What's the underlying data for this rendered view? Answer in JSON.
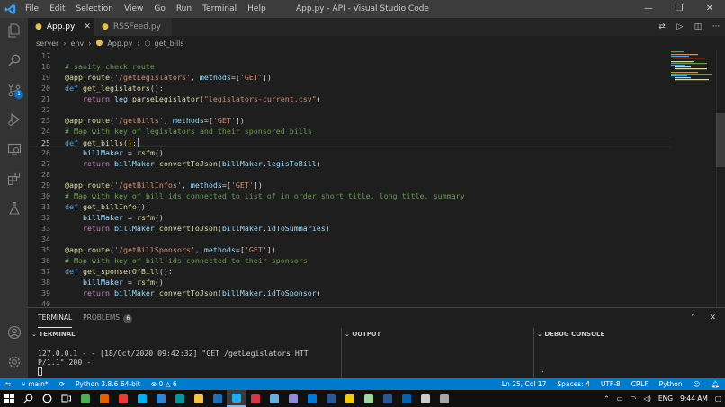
{
  "window": {
    "title": "App.py - API - Visual Studio Code",
    "menu": [
      "File",
      "Edit",
      "Selection",
      "View",
      "Go",
      "Run",
      "Terminal",
      "Help"
    ],
    "controls": [
      "—",
      "❐",
      "✕"
    ]
  },
  "activity_bar": {
    "items": [
      "explorer-icon",
      "search-icon",
      "source-control-icon",
      "run-debug-icon",
      "remote-explorer-icon",
      "extensions-icon",
      "testing-icon"
    ],
    "source_control_badge": "1",
    "bottom": [
      "account-icon",
      "manage-gear-icon"
    ]
  },
  "tabs": [
    {
      "label": "App.py",
      "active": true
    },
    {
      "label": "RSSFeed.py",
      "active": false
    }
  ],
  "breadcrumb": [
    "server",
    "env",
    "App.py",
    "get_bills"
  ],
  "editor": {
    "lines": [
      {
        "n": "17",
        "tokens": []
      },
      {
        "n": "18",
        "tokens": [
          [
            "c",
            "# sanity check route"
          ]
        ]
      },
      {
        "n": "19",
        "tokens": [
          [
            "dec",
            "@app.route"
          ],
          [
            "p",
            "("
          ],
          [
            "s",
            "'/getLegislators'"
          ],
          [
            "p",
            ", "
          ],
          [
            "v",
            "methods"
          ],
          [
            "p",
            "=["
          ],
          [
            "s",
            "'GET'"
          ],
          [
            "p",
            "])"
          ]
        ]
      },
      {
        "n": "20",
        "tokens": [
          [
            "kb",
            "def "
          ],
          [
            "fn",
            "get_legislators"
          ],
          [
            "p",
            "():"
          ]
        ]
      },
      {
        "n": "21",
        "tokens": [
          [
            "p",
            "    "
          ],
          [
            "k",
            "return "
          ],
          [
            "v",
            "leg"
          ],
          [
            "p",
            "."
          ],
          [
            "fn",
            "parseLegislator"
          ],
          [
            "p",
            "("
          ],
          [
            "s",
            "\"legislators-current.csv\""
          ],
          [
            "p",
            ")"
          ]
        ]
      },
      {
        "n": "22",
        "tokens": []
      },
      {
        "n": "23",
        "tokens": [
          [
            "dec",
            "@app.route"
          ],
          [
            "p",
            "("
          ],
          [
            "s",
            "'/getBills'"
          ],
          [
            "p",
            ", "
          ],
          [
            "v",
            "methods"
          ],
          [
            "p",
            "=["
          ],
          [
            "s",
            "'GET'"
          ],
          [
            "p",
            "])"
          ]
        ]
      },
      {
        "n": "24",
        "tokens": [
          [
            "c",
            "# Map with key of legislators and their sponsored bills"
          ]
        ]
      },
      {
        "n": "25",
        "tokens": [
          [
            "kb",
            "def "
          ],
          [
            "fn",
            "get_bills"
          ],
          [
            "b",
            "()"
          ],
          [
            "p",
            ":"
          ]
        ],
        "current": true
      },
      {
        "n": "26",
        "tokens": [
          [
            "p",
            "    "
          ],
          [
            "v",
            "billMaker"
          ],
          [
            "p",
            " = "
          ],
          [
            "fn",
            "rsfm"
          ],
          [
            "p",
            "()"
          ]
        ]
      },
      {
        "n": "27",
        "tokens": [
          [
            "p",
            "    "
          ],
          [
            "k",
            "return "
          ],
          [
            "v",
            "billMaker"
          ],
          [
            "p",
            "."
          ],
          [
            "fn",
            "convertToJson"
          ],
          [
            "p",
            "("
          ],
          [
            "v",
            "billMaker"
          ],
          [
            "p",
            "."
          ],
          [
            "v",
            "legisToBill"
          ],
          [
            "p",
            ")"
          ]
        ]
      },
      {
        "n": "28",
        "tokens": []
      },
      {
        "n": "29",
        "tokens": [
          [
            "dec",
            "@app.route"
          ],
          [
            "p",
            "("
          ],
          [
            "s",
            "'/getBillInfos'"
          ],
          [
            "p",
            ", "
          ],
          [
            "v",
            "methods"
          ],
          [
            "p",
            "=["
          ],
          [
            "s",
            "'GET'"
          ],
          [
            "p",
            "])"
          ]
        ]
      },
      {
        "n": "30",
        "tokens": [
          [
            "c",
            "# Map with key of bill ids connected to list of in order short title, long title, summary"
          ]
        ]
      },
      {
        "n": "31",
        "tokens": [
          [
            "kb",
            "def "
          ],
          [
            "fn",
            "get_billInfo"
          ],
          [
            "p",
            "():"
          ]
        ]
      },
      {
        "n": "32",
        "tokens": [
          [
            "p",
            "    "
          ],
          [
            "v",
            "billMaker"
          ],
          [
            "p",
            " = "
          ],
          [
            "fn",
            "rsfm"
          ],
          [
            "p",
            "()"
          ]
        ]
      },
      {
        "n": "33",
        "tokens": [
          [
            "p",
            "    "
          ],
          [
            "k",
            "return "
          ],
          [
            "v",
            "billMaker"
          ],
          [
            "p",
            "."
          ],
          [
            "fn",
            "convertToJson"
          ],
          [
            "p",
            "("
          ],
          [
            "v",
            "billMaker"
          ],
          [
            "p",
            "."
          ],
          [
            "v",
            "idToSummaries"
          ],
          [
            "p",
            ")"
          ]
        ]
      },
      {
        "n": "34",
        "tokens": []
      },
      {
        "n": "35",
        "tokens": [
          [
            "dec",
            "@app.route"
          ],
          [
            "p",
            "("
          ],
          [
            "s",
            "'/getBillSponsors'"
          ],
          [
            "p",
            ", "
          ],
          [
            "v",
            "methods"
          ],
          [
            "p",
            "=["
          ],
          [
            "s",
            "'GET'"
          ],
          [
            "p",
            "])"
          ]
        ]
      },
      {
        "n": "36",
        "tokens": [
          [
            "c",
            "# Map with key of bill ids connected to their sponsors"
          ]
        ]
      },
      {
        "n": "37",
        "tokens": [
          [
            "kb",
            "def "
          ],
          [
            "fn",
            "get_sponserOfBill"
          ],
          [
            "p",
            "():"
          ]
        ]
      },
      {
        "n": "38",
        "tokens": [
          [
            "p",
            "    "
          ],
          [
            "v",
            "billMaker"
          ],
          [
            "p",
            " = "
          ],
          [
            "fn",
            "rsfm"
          ],
          [
            "p",
            "()"
          ]
        ]
      },
      {
        "n": "39",
        "tokens": [
          [
            "p",
            "    "
          ],
          [
            "k",
            "return "
          ],
          [
            "v",
            "billMaker"
          ],
          [
            "p",
            "."
          ],
          [
            "fn",
            "convertToJson"
          ],
          [
            "p",
            "("
          ],
          [
            "v",
            "billMaker"
          ],
          [
            "p",
            "."
          ],
          [
            "v",
            "idToSponsor"
          ],
          [
            "p",
            ")"
          ]
        ]
      },
      {
        "n": "40",
        "tokens": []
      }
    ]
  },
  "panel": {
    "tabs": [
      {
        "label": "TERMINAL",
        "active": true
      },
      {
        "label": "PROBLEMS",
        "active": false,
        "count": "6"
      }
    ],
    "sections": {
      "terminal": "TERMINAL",
      "output": "OUTPUT",
      "debug": "DEBUG CONSOLE"
    },
    "terminal_lines": [
      "127.0.0.1 - - [18/Oct/2020 09:42:32] \"GET /getLegislators HTT",
      "P/1.1\" 200 -"
    ]
  },
  "statusbar": {
    "branch": "main*",
    "python": "Python 3.8.6 64-bit",
    "errors": "0",
    "warnings": "6",
    "position": "Ln 25, Col 17",
    "spaces": "Spaces: 4",
    "encoding": "UTF-8",
    "eol": "CRLF",
    "language": "Python"
  },
  "taskbar": {
    "apps": [
      {
        "name": "chrome-icon",
        "color": "#4caf50"
      },
      {
        "name": "firefox-icon",
        "color": "#e66000"
      },
      {
        "name": "vivaldi-icon",
        "color": "#ef3939"
      },
      {
        "name": "skype-icon",
        "color": "#00aff0"
      },
      {
        "name": "copilot-icon",
        "color": "#2b88d8"
      },
      {
        "name": "arduino-icon",
        "color": "#00979c"
      },
      {
        "name": "file-explorer-icon",
        "color": "#f6c343"
      },
      {
        "name": "files-icon",
        "color": "#1d6fb8"
      },
      {
        "name": "vscode-taskbar-icon",
        "color": "#23a9f2",
        "active": true
      },
      {
        "name": "pdf-icon",
        "color": "#d4374a"
      },
      {
        "name": "notepad-icon",
        "color": "#6ab0de"
      },
      {
        "name": "app-icon-1",
        "color": "#8e8cd8"
      },
      {
        "name": "app-icon-2",
        "color": "#0078d7"
      },
      {
        "name": "app-icon-3",
        "color": "#2b579a"
      },
      {
        "name": "app-icon-4",
        "color": "#f2c811"
      },
      {
        "name": "app-icon-5",
        "color": "#9fd89f"
      },
      {
        "name": "word-icon",
        "color": "#2b579a"
      },
      {
        "name": "app-icon-6",
        "color": "#0063b1"
      },
      {
        "name": "settings-icon",
        "color": "#cccccc"
      },
      {
        "name": "app-icon-7",
        "color": "#a6a6a6"
      }
    ],
    "language": "ENG",
    "time": "9:44 AM"
  }
}
